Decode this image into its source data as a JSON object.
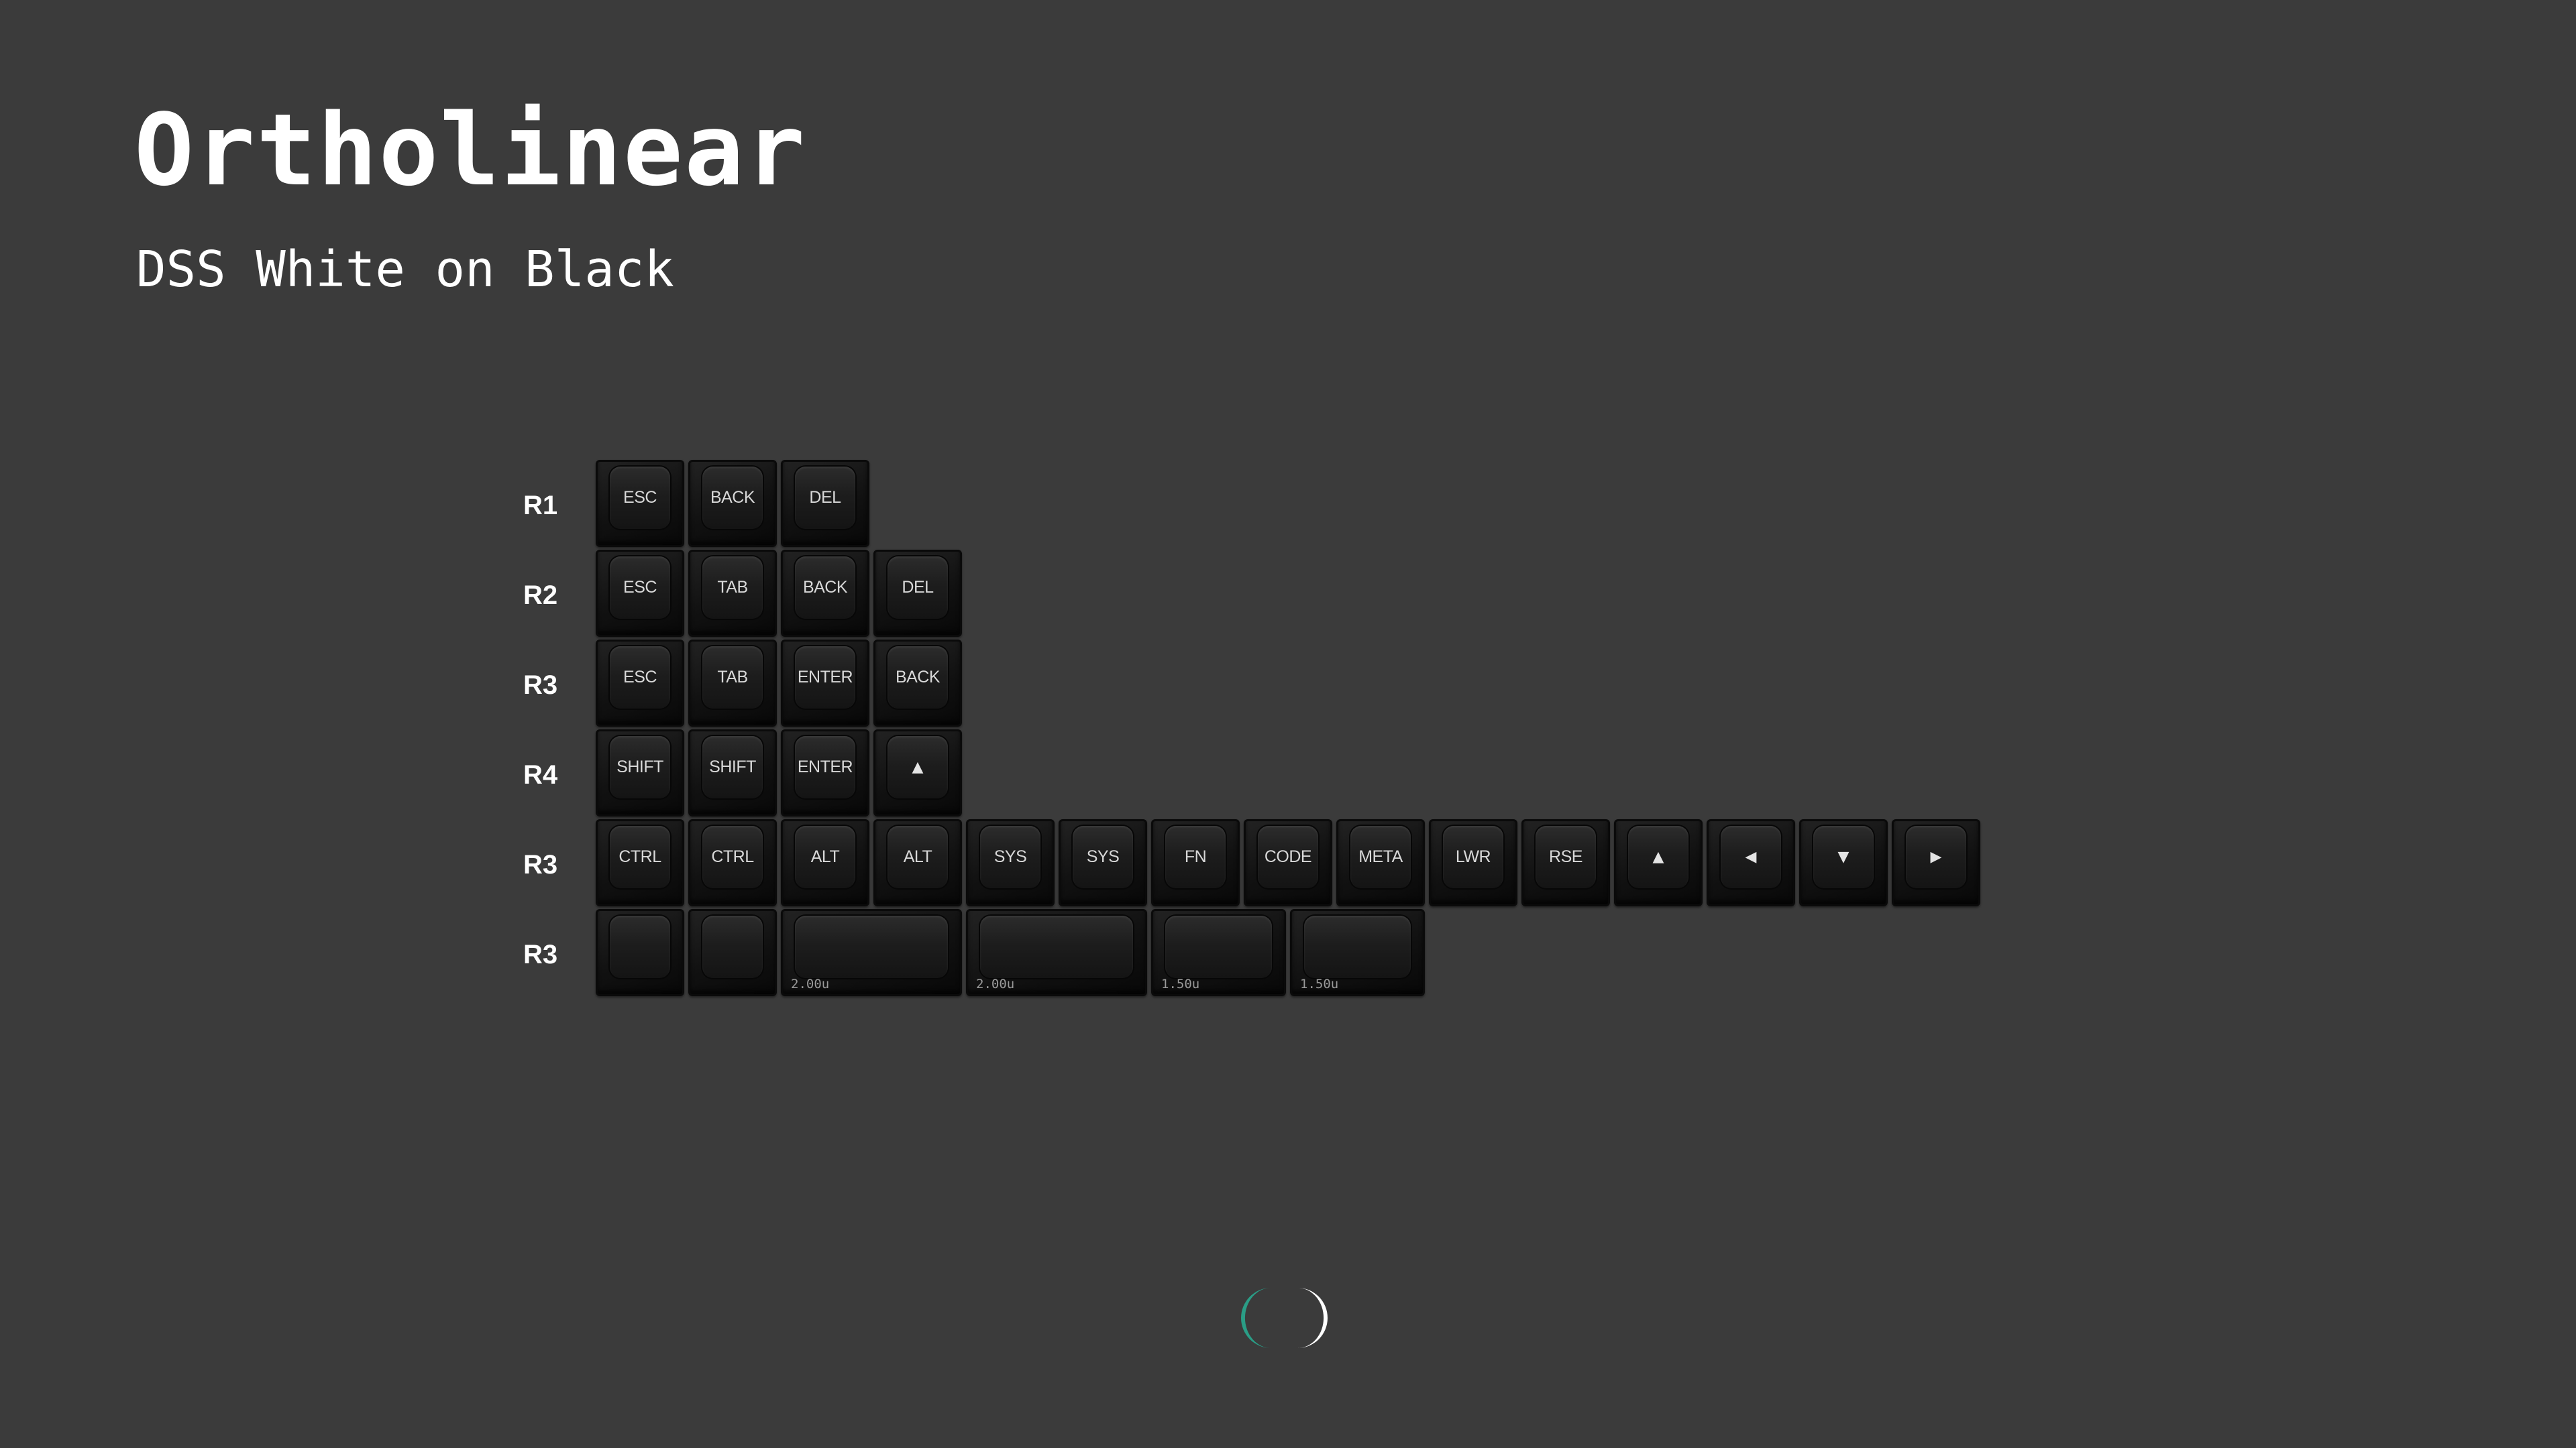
{
  "header": {
    "title": "Ortholinear",
    "subtitle": "DSS White on Black"
  },
  "rows": [
    {
      "label": "R1",
      "keys": [
        {
          "legend": "ESC"
        },
        {
          "legend": "BACK"
        },
        {
          "legend": "DEL"
        }
      ]
    },
    {
      "label": "R2",
      "keys": [
        {
          "legend": "ESC"
        },
        {
          "legend": "TAB"
        },
        {
          "legend": "BACK"
        },
        {
          "legend": "DEL"
        }
      ]
    },
    {
      "label": "R3",
      "keys": [
        {
          "legend": "ESC"
        },
        {
          "legend": "TAB"
        },
        {
          "legend": "ENTER"
        },
        {
          "legend": "BACK"
        }
      ]
    },
    {
      "label": "R4",
      "keys": [
        {
          "legend": "SHIFT"
        },
        {
          "legend": "SHIFT"
        },
        {
          "legend": "ENTER"
        },
        {
          "legend": "▲",
          "icon": "arrow-up-icon"
        }
      ]
    },
    {
      "label": "R3",
      "keys": [
        {
          "legend": "CTRL"
        },
        {
          "legend": "CTRL"
        },
        {
          "legend": "ALT"
        },
        {
          "legend": "ALT"
        },
        {
          "legend": "SYS"
        },
        {
          "legend": "SYS"
        },
        {
          "legend": "FN"
        },
        {
          "legend": "CODE"
        },
        {
          "legend": "META"
        },
        {
          "legend": "LWR"
        },
        {
          "legend": "RSE"
        },
        {
          "legend": "▲",
          "icon": "arrow-up-icon"
        },
        {
          "legend": "◀",
          "icon": "arrow-left-icon"
        },
        {
          "legend": "▼",
          "icon": "arrow-down-icon"
        },
        {
          "legend": "▶",
          "icon": "arrow-right-icon"
        }
      ]
    },
    {
      "label": "R3",
      "keys": [
        {
          "legend": "",
          "units": 1
        },
        {
          "legend": "",
          "units": 1
        },
        {
          "legend": "",
          "units": 2,
          "size_label": "2.00u"
        },
        {
          "legend": "",
          "units": 2,
          "size_label": "2.00u"
        },
        {
          "legend": "",
          "units": 1.5,
          "size_label": "1.50u"
        },
        {
          "legend": "",
          "units": 1.5,
          "size_label": "1.50u"
        }
      ]
    }
  ],
  "colors": {
    "background": "#3b3b3b",
    "keycap": "#111111",
    "legend": "#d8d8d8",
    "logo_accent": "#2a9d86",
    "logo_light": "#ffffff"
  },
  "logo": {
    "icon": "brand-logo-icon"
  }
}
